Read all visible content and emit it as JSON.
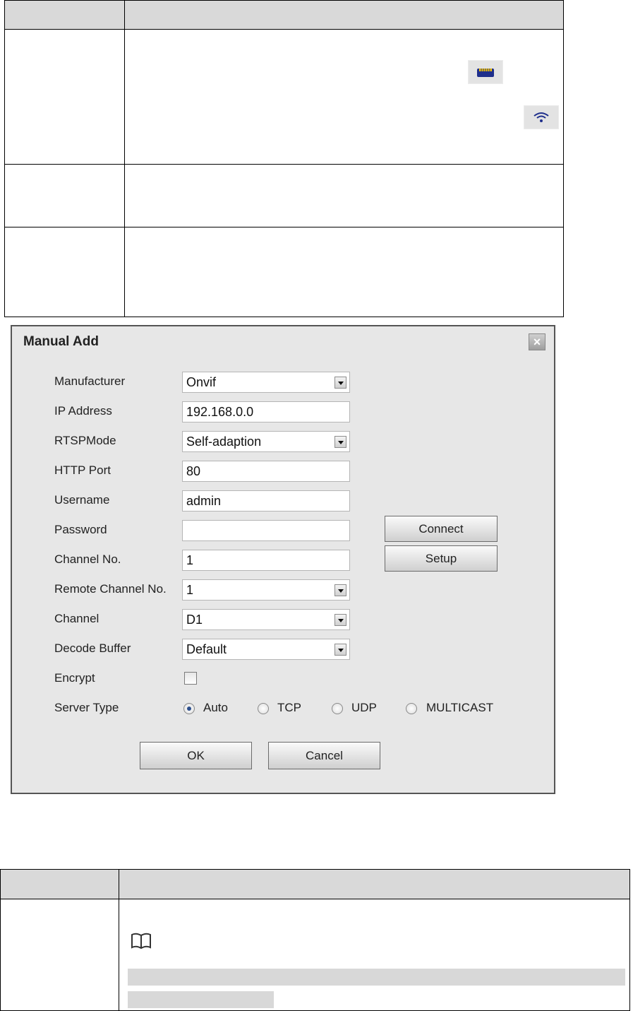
{
  "top_table": {
    "icons": [
      "wired-network-icon",
      "wifi-icon"
    ]
  },
  "dialog": {
    "title": "Manual Add",
    "close_icon": "close-icon",
    "fields": {
      "manufacturer": {
        "label": "Manufacturer",
        "value": "Onvif"
      },
      "ip_address": {
        "label": "IP Address",
        "value": "192.168.0.0"
      },
      "rtsp_mode": {
        "label": "RTSPMode",
        "value": "Self-adaption"
      },
      "http_port": {
        "label": "HTTP Port",
        "value": "80"
      },
      "username": {
        "label": "Username",
        "value": "admin"
      },
      "password": {
        "label": "Password",
        "value": ""
      },
      "channel_no": {
        "label": "Channel No.",
        "value": "1"
      },
      "remote_channel_no": {
        "label": "Remote Channel No.",
        "value": "1"
      },
      "channel": {
        "label": "Channel",
        "value": "D1"
      },
      "decode_buffer": {
        "label": "Decode Buffer",
        "value": "Default"
      },
      "encrypt": {
        "label": "Encrypt",
        "checked": false
      },
      "server_type": {
        "label": "Server Type",
        "options": [
          "Auto",
          "TCP",
          "UDP",
          "MULTICAST"
        ],
        "selected": "Auto"
      }
    },
    "buttons": {
      "connect": "Connect",
      "setup": "Setup",
      "ok": "OK",
      "cancel": "Cancel"
    }
  },
  "bottom_table": {
    "note_icon": "book-note-icon"
  }
}
